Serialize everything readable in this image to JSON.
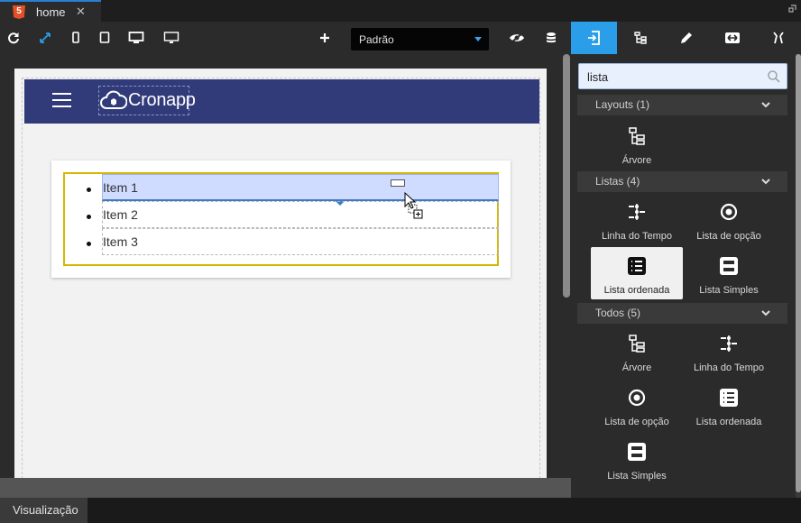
{
  "tab": {
    "title": "home",
    "close": "✕",
    "html5": "5"
  },
  "toolbar": {
    "select_value": "Padrão"
  },
  "canvas": {
    "logo_text": "Cronapp",
    "list_items": [
      "Item 1",
      "Item 2",
      "Item 3"
    ]
  },
  "search": {
    "value": "lista",
    "placeholder": ""
  },
  "sections": [
    {
      "label": "Layouts (1)"
    },
    {
      "label": "Listas (4)"
    },
    {
      "label": "Todos (5)"
    }
  ],
  "components": {
    "layouts": [
      "Árvore"
    ],
    "listas": [
      "Linha do Tempo",
      "Lista de opção",
      "Lista ordenada",
      "Lista Simples"
    ],
    "todos": [
      "Árvore",
      "Linha do Tempo",
      "Lista de opção",
      "Lista ordenada",
      "Lista Simples"
    ]
  },
  "status": {
    "tab_label": "Visualização"
  },
  "colors": {
    "accent": "#2a9ee8",
    "navbar": "#323b7a",
    "selection": "#d4b800"
  }
}
